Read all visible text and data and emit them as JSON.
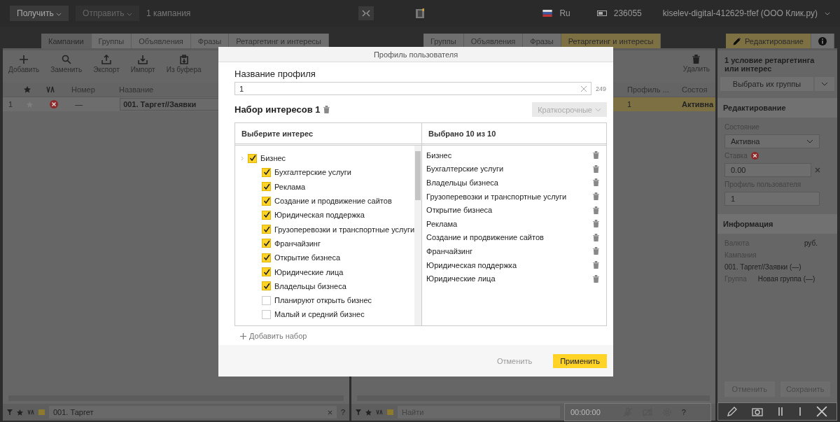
{
  "top_bar": {
    "receive_button": "Получить",
    "send_button": "Отправить",
    "campaign_count": "1 кампания",
    "language": "Ru",
    "balance": "236055",
    "account": "kiselev-digital-412629-tfef (ООО Клик.ру)"
  },
  "left_panel": {
    "tabs": [
      {
        "label": "Кампании",
        "selected": true
      },
      {
        "label": "Группы",
        "selected": false
      },
      {
        "label": "Объявления",
        "selected": false
      },
      {
        "label": "Фразы",
        "selected": false
      },
      {
        "label": "Ретаргетинг и интересы",
        "selected": false
      }
    ],
    "toolbar": [
      {
        "kind": "add",
        "label": "Добавить"
      },
      {
        "kind": "replace",
        "label": "Заменить"
      },
      {
        "kind": "export",
        "label": "Экспорт"
      },
      {
        "kind": "import",
        "label": "Импорт"
      },
      {
        "kind": "clipboard",
        "label": "Из буфера"
      }
    ],
    "columns": [
      "Номер",
      "Название"
    ],
    "row": {
      "index": "1",
      "number": "—",
      "name": "001. Таргет//Заявки"
    },
    "filter": {
      "value": "001. Таргет",
      "help": "?"
    }
  },
  "middle_panel": {
    "tabs": [
      {
        "label": "Группы",
        "selected": false
      },
      {
        "label": "Объявления",
        "selected": false
      },
      {
        "label": "Фразы",
        "selected": false
      },
      {
        "label": "Ретаргетинг и интересы",
        "selected": true
      }
    ],
    "delete_button": "Удалить",
    "columns": [
      "Профиль ...",
      "Состоя"
    ],
    "row": {
      "profile": "1",
      "status": "Активна"
    },
    "search": {
      "placeholder": "Найти",
      "help": "?"
    }
  },
  "recorder": {
    "timer": "00:00:00"
  },
  "right_panel": {
    "tabs": [
      {
        "kind": "edit",
        "label": "Редактирование",
        "selected": true
      },
      {
        "kind": "info",
        "selected": false
      }
    ],
    "title": "1 условие ретаргетинга или интерес",
    "group_button": "Выбрать их группы",
    "edit_section": "Редактирование",
    "status_label": "Состояние",
    "status_value": "Активна",
    "bid_label": "Ставка",
    "bid_value": "0.00",
    "profile_label": "Профиль пользователя",
    "profile_value": "1",
    "info_section": "Информация",
    "currency_label": "Валюта",
    "currency_value": "руб.",
    "campaign_label": "Кампания",
    "campaign_value": "001. Таргет//Заявки (—)",
    "group_label": "Группа",
    "group_value": "Новая группа (—)",
    "cancel_button": "Отменить",
    "save_button": "Сохранить"
  },
  "modal": {
    "title": "Профиль пользователя",
    "name_label": "Название профиля",
    "name_value": "1",
    "counter": "249",
    "set_title": "Набор интересов 1",
    "duration": "Краткосрочные",
    "left_header": "Выберите интерес",
    "right_header": "Выбрано 10 из 10",
    "tree": [
      {
        "label": "Бизнес",
        "checked": true,
        "children": [
          {
            "label": "Бухгалтерские услуги",
            "checked": true
          },
          {
            "label": "Реклама",
            "checked": true
          },
          {
            "label": "Создание и продвижение сайтов",
            "checked": true
          },
          {
            "label": "Юридическая поддержка",
            "checked": true
          },
          {
            "label": "Грузоперевозки и транспортные услуги",
            "checked": true
          },
          {
            "label": "Франчайзинг",
            "checked": true
          },
          {
            "label": "Открытие бизнеса",
            "checked": true
          },
          {
            "label": "Юридические лица",
            "checked": true
          },
          {
            "label": "Владельцы бизнеса",
            "checked": true
          },
          {
            "label": "Планируют открыть бизнес",
            "checked": false
          },
          {
            "label": "Малый и средний бизнес",
            "checked": false
          }
        ]
      }
    ],
    "selected": [
      "Бизнес",
      "Бухгалтерские услуги",
      "Владельцы бизнеса",
      "Грузоперевозки и транспортные услуги",
      "Открытие бизнеса",
      "Реклама",
      "Создание и продвижение сайтов",
      "Франчайзинг",
      "Юридическая поддержка",
      "Юридические лица"
    ],
    "add_set": "Добавить набор",
    "cancel_button": "Отменить",
    "apply_button": "Применить"
  }
}
